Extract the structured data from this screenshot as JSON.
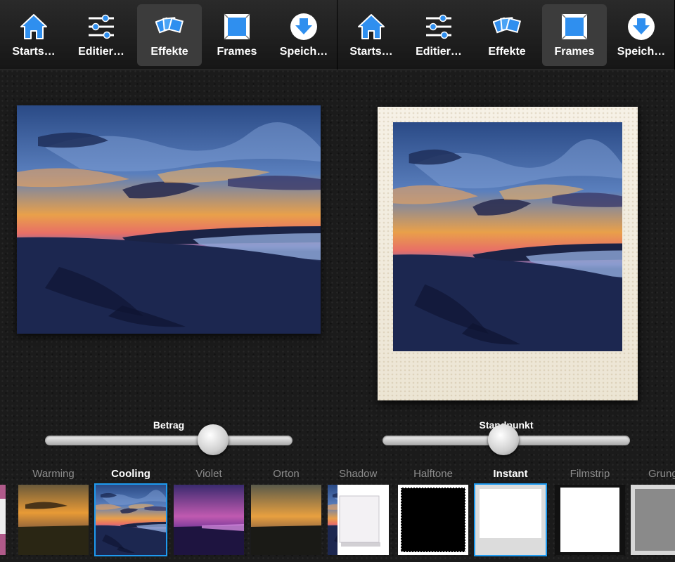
{
  "left_panel": {
    "toolbar": [
      {
        "label": "Starts…",
        "icon": "home-icon"
      },
      {
        "label": "Editier…",
        "icon": "sliders-icon"
      },
      {
        "label": "Effekte",
        "icon": "effects-icon",
        "active": true
      },
      {
        "label": "Frames",
        "icon": "frame-icon"
      },
      {
        "label": "Speich…",
        "icon": "save-download-icon"
      }
    ],
    "slider": {
      "label": "Betrag",
      "value": 0.68
    },
    "effects": [
      "",
      "Warming",
      "Cooling",
      "Violet",
      "Orton"
    ],
    "selected_effect": "Cooling"
  },
  "right_panel": {
    "toolbar": [
      {
        "label": "Starts…",
        "icon": "home-icon"
      },
      {
        "label": "Editier…",
        "icon": "sliders-icon"
      },
      {
        "label": "Effekte",
        "icon": "effects-icon"
      },
      {
        "label": "Frames",
        "icon": "frame-icon",
        "active": true
      },
      {
        "label": "Speich…",
        "icon": "save-download-icon"
      }
    ],
    "slider": {
      "label": "Standpunkt",
      "value": 0.49
    },
    "frames": [
      "p Shadow",
      "Halftone",
      "Instant",
      "Filmstrip",
      "Grunge"
    ],
    "selected_frame": "Instant"
  },
  "colors": {
    "accent": "#1e9aef",
    "icon_blue": "#2f8fef"
  }
}
